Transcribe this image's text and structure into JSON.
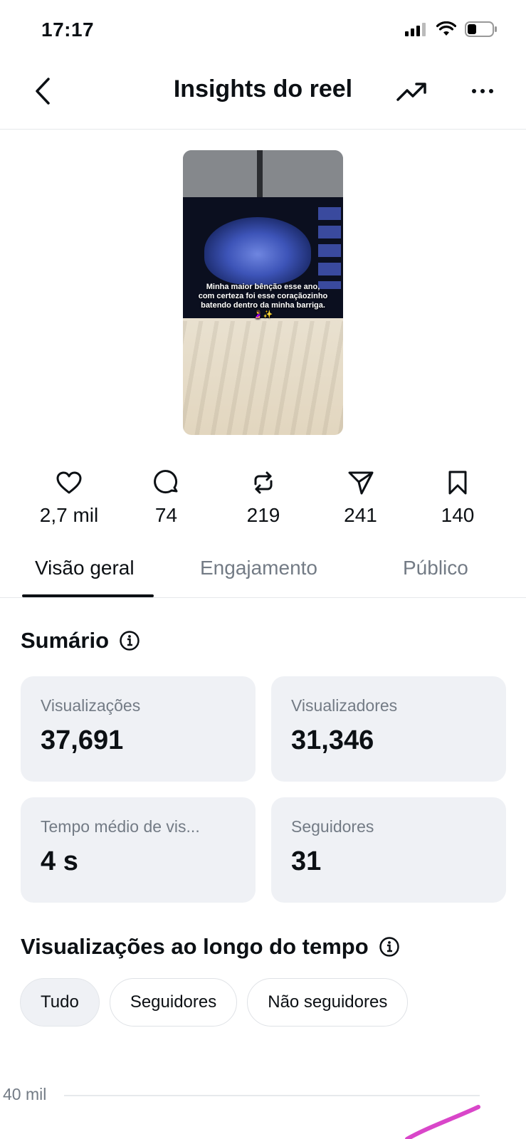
{
  "status_bar": {
    "time": "17:17"
  },
  "nav": {
    "title": "Insights do reel",
    "back_icon": "chevron-left-icon",
    "trend_icon": "trending-up-icon",
    "more_icon": "more-horizontal-icon"
  },
  "thumbnail": {
    "caption": "Minha maior bênção esse ano, com certeza foi esse coraçãozinho batendo dentro da minha barriga. 🤰✨"
  },
  "stats": [
    {
      "icon": "heart-icon",
      "value": "2,7 mil"
    },
    {
      "icon": "comment-icon",
      "value": "74"
    },
    {
      "icon": "repost-icon",
      "value": "219"
    },
    {
      "icon": "send-icon",
      "value": "241"
    },
    {
      "icon": "bookmark-icon",
      "value": "140"
    }
  ],
  "tabs": [
    {
      "label": "Visão geral",
      "active": true
    },
    {
      "label": "Engajamento",
      "active": false
    },
    {
      "label": "Público",
      "active": false
    }
  ],
  "summary": {
    "title": "Sumário",
    "cards": [
      {
        "label": "Visualizações",
        "value": "37,691"
      },
      {
        "label": "Visualizadores",
        "value": "31,346"
      },
      {
        "label": "Tempo médio de vis...",
        "value": "4 s"
      },
      {
        "label": "Seguidores",
        "value": "31"
      }
    ]
  },
  "views_over_time": {
    "title": "Visualizações ao longo do tempo",
    "filters": [
      {
        "label": "Tudo",
        "selected": true
      },
      {
        "label": "Seguidores",
        "selected": false
      },
      {
        "label": "Não seguidores",
        "selected": false
      }
    ],
    "y_tick_label": "40 mil",
    "line_color": "#d946c9"
  }
}
